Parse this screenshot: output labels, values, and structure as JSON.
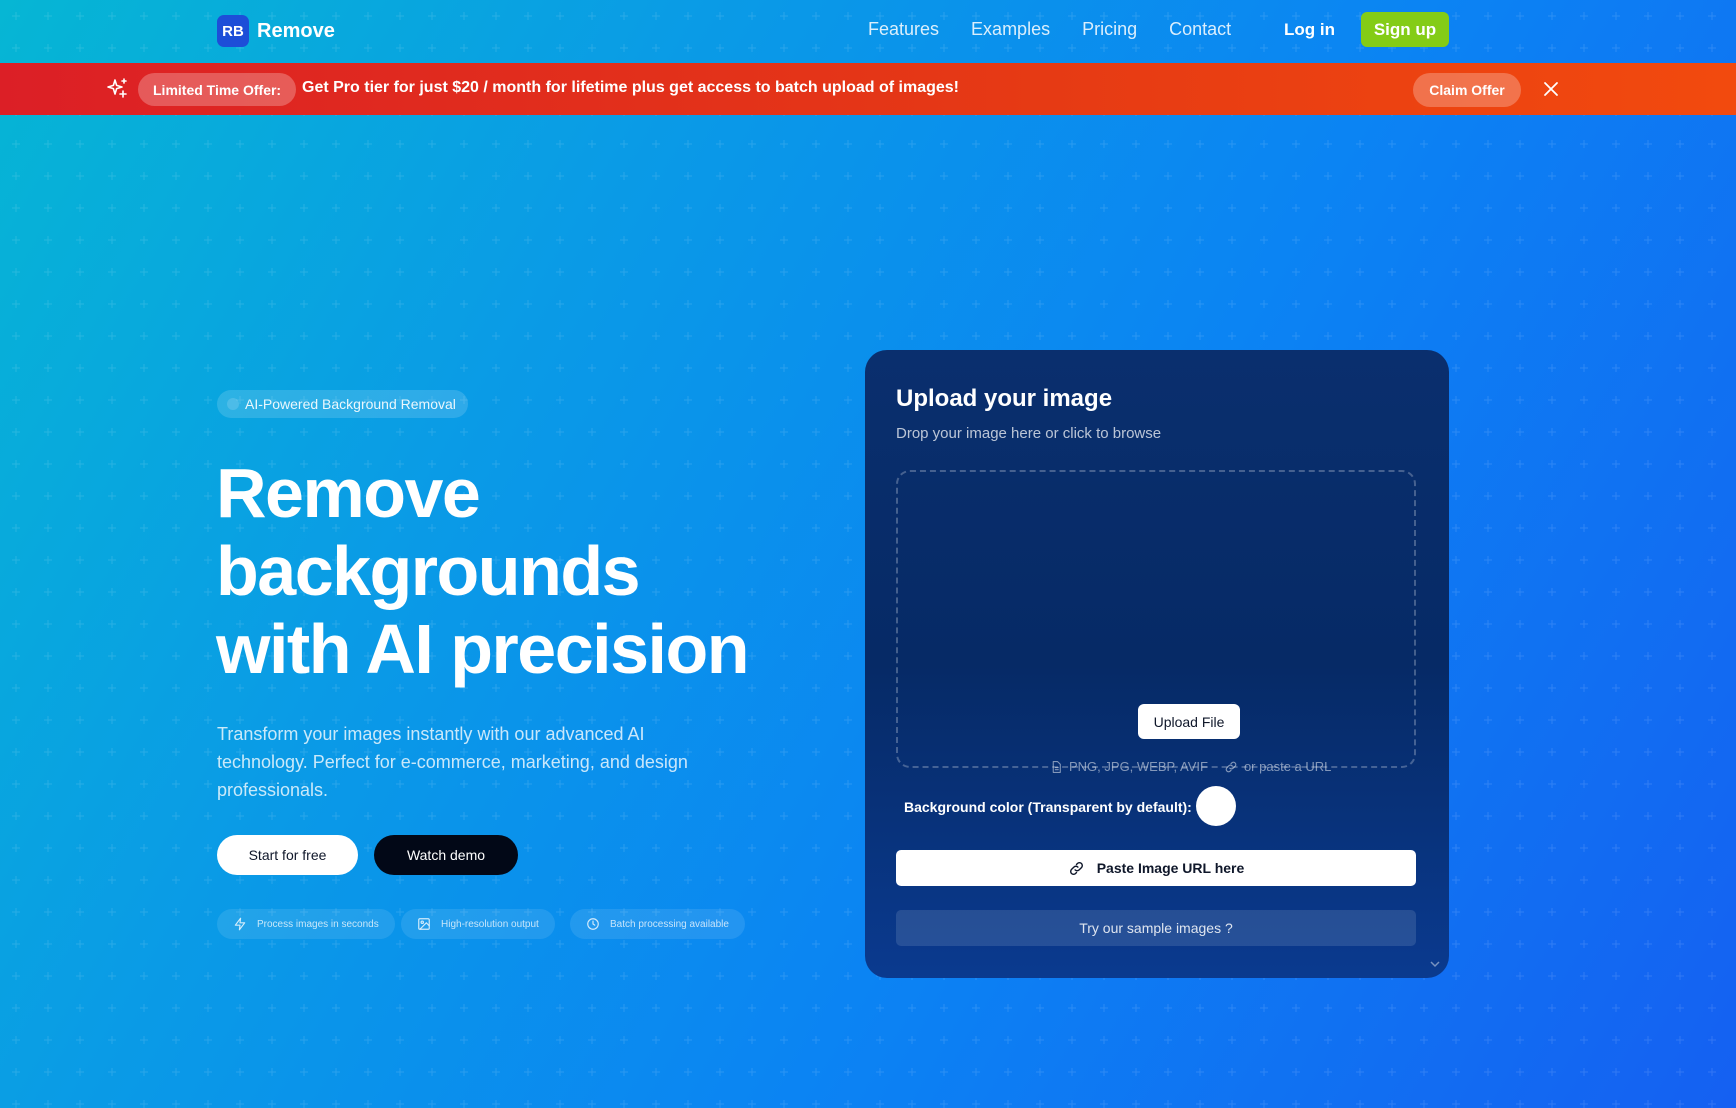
{
  "header": {
    "logo_badge": "RB",
    "logo_text": "Remove",
    "nav": [
      "Features",
      "Examples",
      "Pricing",
      "Contact"
    ],
    "login": "Log in",
    "signup": "Sign up"
  },
  "promo": {
    "pill": "Limited Time Offer:",
    "message": "Get Pro tier for just $20 / month for lifetime plus get access to batch upload of images!",
    "claim": "Claim Offer"
  },
  "hero": {
    "tag": "AI-Powered Background Removal",
    "headline_line1": "Remove",
    "headline_line2": "backgrounds",
    "headline_line3": "with AI precision",
    "subtext": "Transform your images instantly with our advanced AI technology. Perfect for e-commerce, marketing, and design professionals.",
    "start_button": "Start for free",
    "demo_button": "Watch demo",
    "features": [
      "Process images in seconds",
      "High-resolution output",
      "Batch processing available"
    ]
  },
  "upload": {
    "title": "Upload your image",
    "subtitle": "Drop your image here or click to browse",
    "upload_button": "Upload File",
    "formats": "PNG, JPG, WEBP, AVIF",
    "url_hint": "or paste a URL",
    "bg_color_label": "Background color (Transparent by default):",
    "paste_button": "Paste Image URL here",
    "samples_button": "Try our sample images ?"
  },
  "colors": {
    "signup": "#84cc16",
    "promo_start": "#dc1f26",
    "promo_end": "#f24a0e",
    "card": "#062a66",
    "logo_badge": "#1d4ed8"
  }
}
